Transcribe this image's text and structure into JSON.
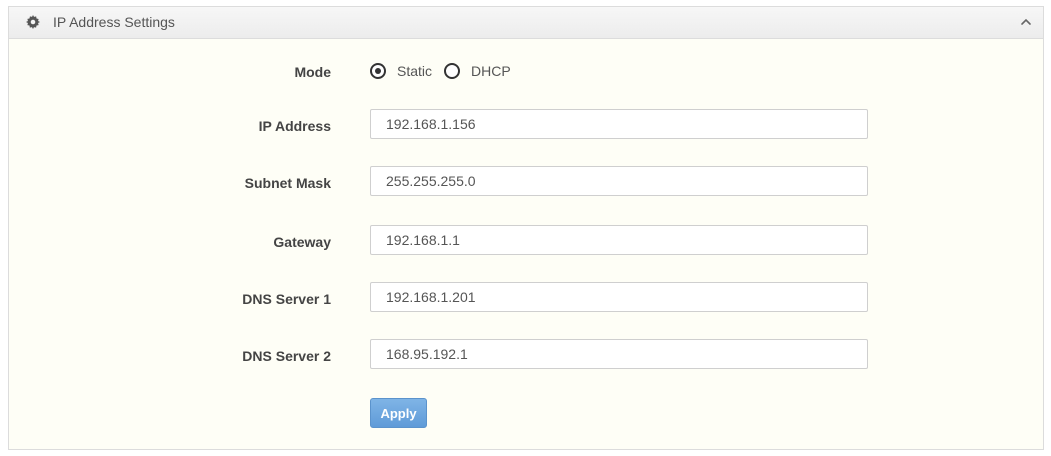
{
  "panel": {
    "title": "IP Address Settings",
    "icon": "gear-icon",
    "collapse_icon": "chevron-up-icon"
  },
  "mode": {
    "label": "Mode",
    "options": [
      {
        "label": "Static",
        "selected": true
      },
      {
        "label": "DHCP",
        "selected": false
      }
    ]
  },
  "fields": {
    "ip_address": {
      "label": "IP Address",
      "value": "192.168.1.156"
    },
    "subnet_mask": {
      "label": "Subnet Mask",
      "value": "255.255.255.0"
    },
    "gateway": {
      "label": "Gateway",
      "value": "192.168.1.1"
    },
    "dns_server_1": {
      "label": "DNS Server 1",
      "value": "192.168.1.201"
    },
    "dns_server_2": {
      "label": "DNS Server 2",
      "value": "168.95.192.1"
    }
  },
  "actions": {
    "apply_label": "Apply"
  },
  "colors": {
    "panel_background": "#fefef6",
    "apply_button": "#6aa6de"
  }
}
